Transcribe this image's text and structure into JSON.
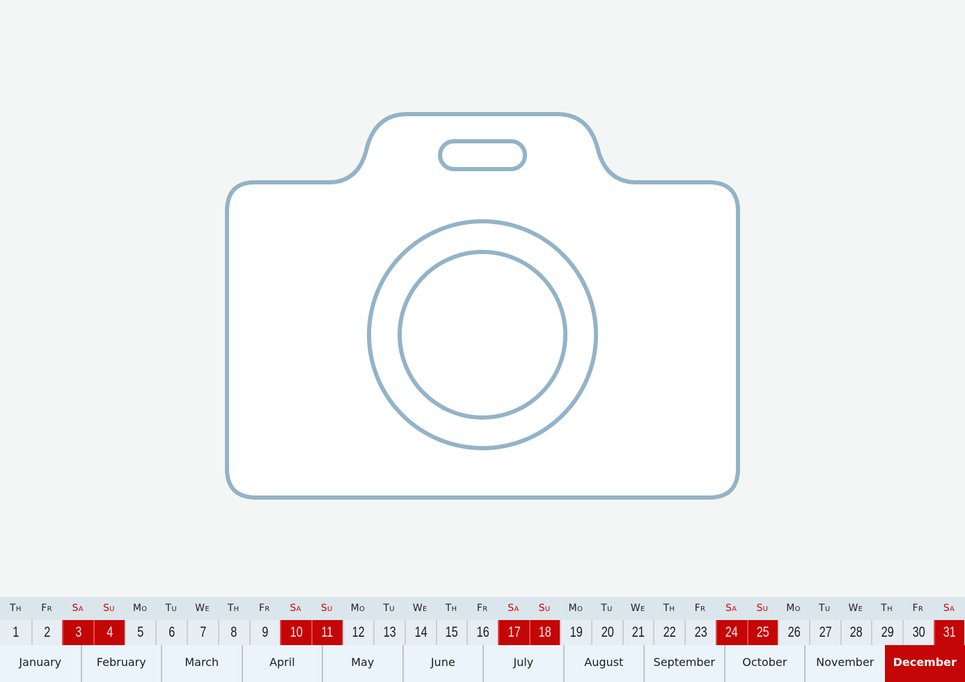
{
  "placeholder": {
    "icon": "camera-icon",
    "stroke_color": "#93b3c8",
    "fill_color": "#ffffff",
    "background_color": "#f4f6f6"
  },
  "calendar": {
    "accent_color": "#c40606",
    "weekdays": [
      "Th",
      "Fr",
      "Sa",
      "Su",
      "Mo",
      "Tu",
      "We",
      "Th",
      "Fr",
      "Sa",
      "Su",
      "Mo",
      "Tu",
      "We",
      "Th",
      "Fr",
      "Sa",
      "Su",
      "Mo",
      "Tu",
      "We",
      "Th",
      "Fr",
      "Sa",
      "Su",
      "Mo",
      "Tu",
      "We",
      "Th",
      "Fr",
      "Sa"
    ],
    "days": [
      "1",
      "2",
      "3",
      "4",
      "5",
      "6",
      "7",
      "8",
      "9",
      "10",
      "11",
      "12",
      "13",
      "14",
      "15",
      "16",
      "17",
      "18",
      "19",
      "20",
      "21",
      "22",
      "23",
      "24",
      "25",
      "26",
      "27",
      "28",
      "29",
      "30",
      "31"
    ],
    "weekend_indices": [
      2,
      3,
      9,
      10,
      16,
      17,
      23,
      24,
      30
    ],
    "months": [
      "January",
      "February",
      "March",
      "April",
      "May",
      "June",
      "July",
      "August",
      "September",
      "October",
      "November",
      "December"
    ],
    "current_month_index": 11
  }
}
